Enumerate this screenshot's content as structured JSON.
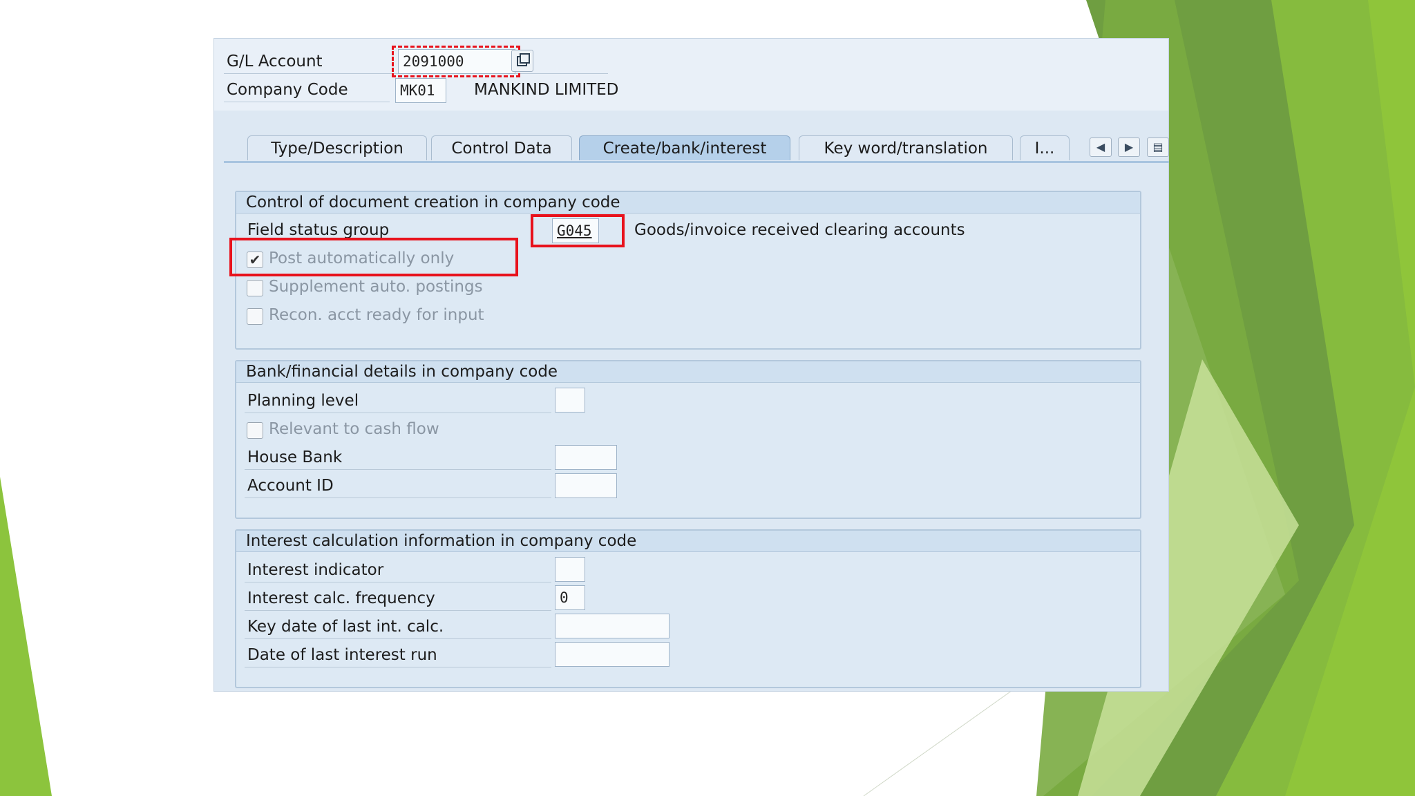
{
  "header": {
    "gl_account_label": "G/L Account",
    "gl_account_value": "2091000",
    "company_code_label": "Company Code",
    "company_code_value": "MK01",
    "company_name": "MANKIND LIMITED"
  },
  "tabs": [
    {
      "label": "Type/Description"
    },
    {
      "label": "Control Data"
    },
    {
      "label": "Create/bank/interest",
      "active": true
    },
    {
      "label": "Key word/translation"
    },
    {
      "label": "I..."
    }
  ],
  "groups": {
    "doc_creation": {
      "title": "Control of document creation in company code",
      "field_status_group_label": "Field status group",
      "field_status_group_value": "G045",
      "field_status_group_desc": "Goods/invoice received clearing accounts",
      "post_auto_only_label": "Post automatically only",
      "post_auto_only_checked": true,
      "supplement_auto_label": "Supplement auto. postings",
      "supplement_auto_checked": false,
      "recon_acct_label": "Recon. acct ready for input",
      "recon_acct_checked": false
    },
    "bank": {
      "title": "Bank/financial details in company code",
      "planning_level_label": "Planning level",
      "planning_level_value": "",
      "cash_flow_label": "Relevant to cash flow",
      "cash_flow_checked": false,
      "house_bank_label": "House Bank",
      "house_bank_value": "",
      "account_id_label": "Account ID",
      "account_id_value": ""
    },
    "interest": {
      "title": "Interest calculation information in company code",
      "indicator_label": "Interest indicator",
      "indicator_value": "",
      "frequency_label": "Interest calc. frequency",
      "frequency_value": "0",
      "key_date_label": "Key date of last int. calc.",
      "key_date_value": "",
      "last_run_label": "Date of last interest run",
      "last_run_value": ""
    }
  },
  "colors": {
    "highlight": "#e8121c",
    "panel": "#dde8f3",
    "green_dark": "#6a9c3c",
    "green_light": "#8cc43d"
  },
  "icons": [
    "copy-icon",
    "checkmark-icon",
    "arrow-left-icon",
    "arrow-right-icon",
    "tab-list-icon"
  ]
}
